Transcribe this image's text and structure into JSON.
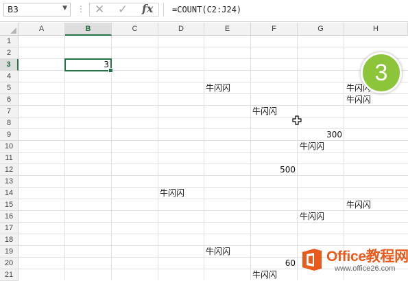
{
  "formula_bar": {
    "name_box": "B3",
    "separator": "⋮",
    "cancel_icon": "✕",
    "enter_icon": "✓",
    "fx_label": "fx",
    "formula": "=COUNT(C2:J24)"
  },
  "columns": [
    "A",
    "B",
    "C",
    "D",
    "E",
    "F",
    "G",
    "H"
  ],
  "rows": [
    "1",
    "2",
    "3",
    "4",
    "5",
    "6",
    "7",
    "8",
    "9",
    "10",
    "11",
    "12",
    "13",
    "14",
    "15",
    "16",
    "17",
    "18",
    "19",
    "20",
    "21"
  ],
  "selected": {
    "column": "B",
    "row": "3",
    "cell": "B3"
  },
  "cells": {
    "b3": "3",
    "e5": "牛闪闪",
    "h5": "牛闪闪",
    "h6": "牛闪闪",
    "f7": "牛闪闪",
    "g9": "300",
    "g10": "牛闪闪",
    "f12": "500",
    "d14": "牛闪闪",
    "h15": "牛闪闪",
    "g16": "牛闪闪",
    "e19": "牛闪闪",
    "f20": "60",
    "f21": "牛闪闪"
  },
  "step_badge": "3",
  "watermark": {
    "title": "Office教程网",
    "url": "www.office26.com"
  },
  "colors": {
    "selection": "#217346",
    "badge": "#8cc43a",
    "watermark": "#e85a1c"
  }
}
